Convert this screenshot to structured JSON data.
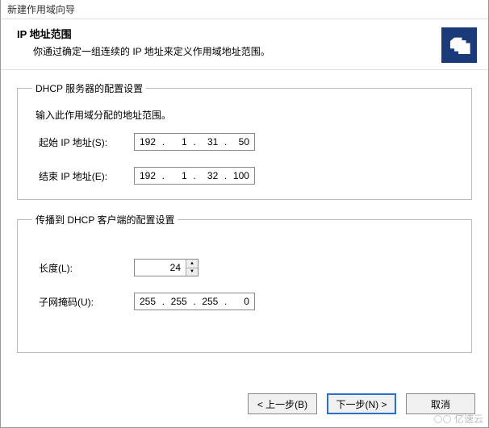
{
  "window_title": "新建作用域向导",
  "header": {
    "title": "IP 地址范围",
    "desc": "你通过确定一组连续的 IP 地址来定义作用域地址范围。"
  },
  "server_settings": {
    "legend": "DHCP 服务器的配置设置",
    "intro": "输入此作用域分配的地址范围。",
    "start_label": "起始 IP 地址(S):",
    "end_label": "结束 IP 地址(E):",
    "start_ip": {
      "o1": "192",
      "o2": "1",
      "o3": "31",
      "o4": "50"
    },
    "end_ip": {
      "o1": "192",
      "o2": "1",
      "o3": "32",
      "o4": "100"
    }
  },
  "client_settings": {
    "legend": "传播到 DHCP 客户端的配置设置",
    "length_label": "长度(L):",
    "length_value": "24",
    "mask_label": "子网掩码(U):",
    "mask": {
      "o1": "255",
      "o2": "255",
      "o3": "255",
      "o4": "0"
    }
  },
  "buttons": {
    "back": "< 上一步(B)",
    "next": "下一步(N) >",
    "cancel": "取消"
  },
  "watermark": "亿速云"
}
